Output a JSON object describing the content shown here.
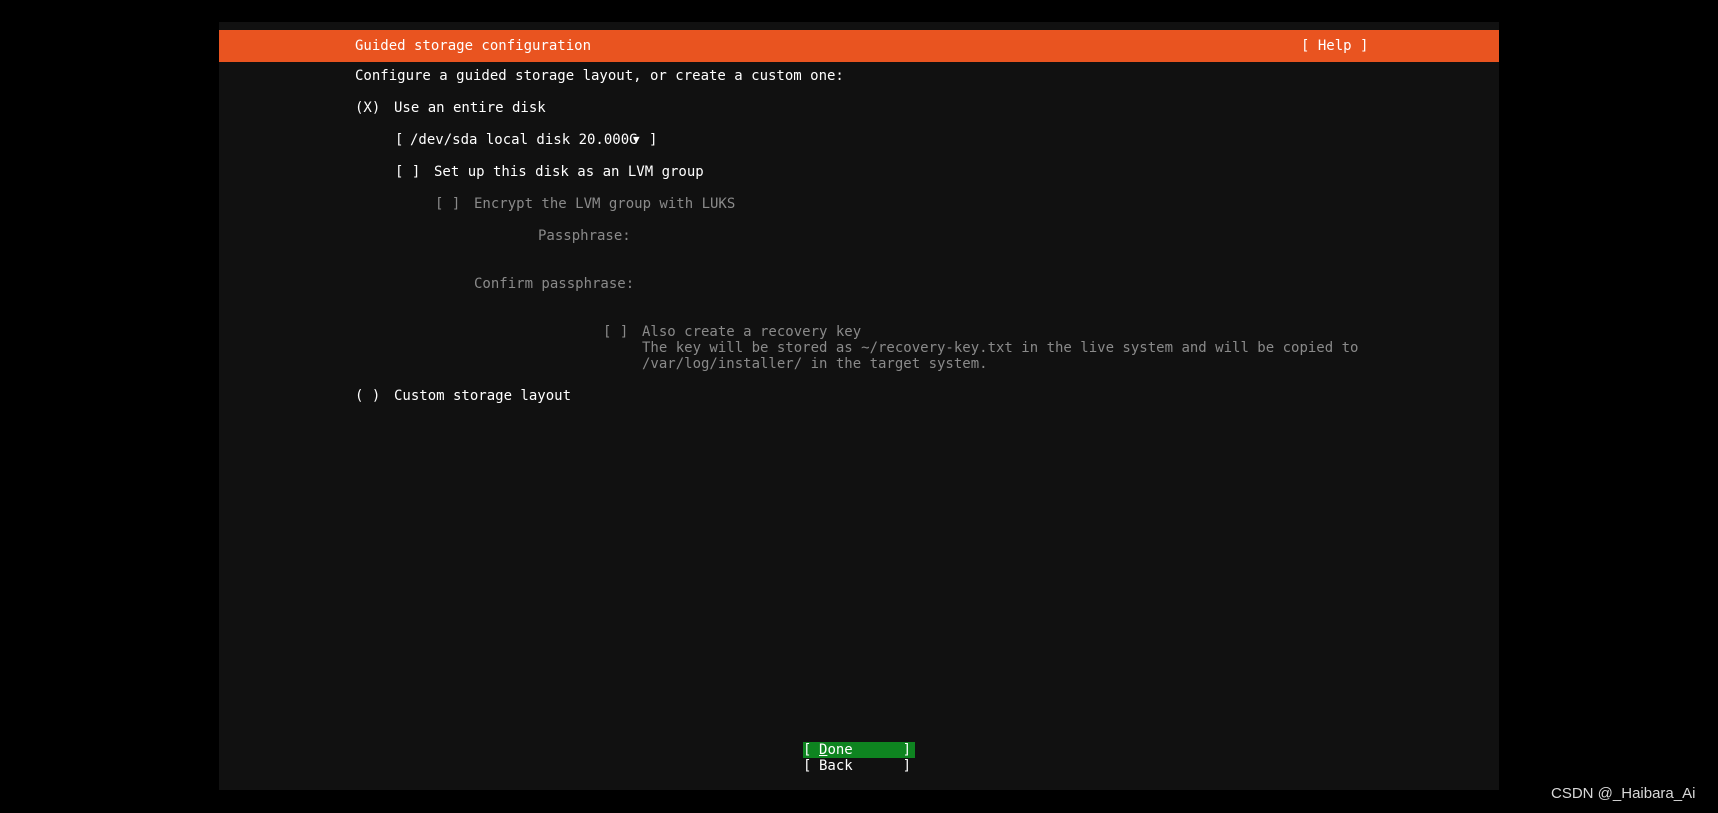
{
  "header": {
    "title": "Guided storage configuration",
    "help_label": "[ Help ]",
    "accent": "#e95420"
  },
  "main": {
    "intro": "Configure a guided storage layout, or create a custom one:",
    "use_entire_disk": {
      "marker": "(X)",
      "label": "Use an entire disk",
      "selected": true
    },
    "disk_select": {
      "open": "[",
      "value": "/dev/sda local disk 20.000G",
      "arrow_icon": "▼",
      "close": "]"
    },
    "lvm_checkbox": {
      "marker": "[ ]",
      "label": "Set up this disk as an LVM group",
      "checked": false
    },
    "encrypt_checkbox": {
      "marker": "[ ]",
      "label": "Encrypt the LVM group with LUKS",
      "checked": false
    },
    "passphrase_label": "Passphrase:",
    "confirm_passphrase_label": "Confirm passphrase:",
    "recovery_checkbox": {
      "marker": "[ ]",
      "label": "Also create a recovery key",
      "help_line1": "The key will be stored as ~/recovery-key.txt in the live system and will be copied to",
      "help_line2": "/var/log/installer/ in the target system.",
      "checked": false
    },
    "custom_layout": {
      "marker": "( )",
      "label": "Custom storage layout",
      "selected": false
    }
  },
  "buttons": {
    "done": {
      "open": "[",
      "first": "D",
      "rest": "one",
      "close": "]",
      "color": "#0e8420"
    },
    "back": {
      "open": "[",
      "label": "Back",
      "close": "]"
    }
  },
  "watermark": "CSDN @_Haibara_Ai"
}
